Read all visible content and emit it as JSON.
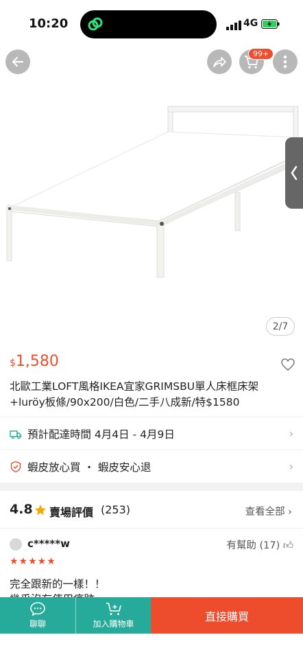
{
  "status": {
    "time": "10:20",
    "network": "4G"
  },
  "header": {
    "cart_badge": "99+"
  },
  "gallery": {
    "page_indicator": "2/7"
  },
  "product": {
    "currency": "$",
    "price": "1,580",
    "title": "北歐工業LOFT風格IKEA宜家GRIMSBU單人床框床架+luröy板條/90x200/白色/二手八成新/特$1580"
  },
  "shipping": {
    "label": "預計配達時間 4月4日 - 4月9日"
  },
  "guarantee": {
    "label": "蝦皮放心買 ・ 蝦皮安心退"
  },
  "ratings": {
    "score": "4.8",
    "title": "賣場評價",
    "count": "(253)",
    "view_all": "查看全部"
  },
  "review": {
    "user": "c*****w",
    "helpful": "有幫助 (17)",
    "stars": "★★★★★",
    "text_line1": "完全跟新的一樣！！",
    "text_line2": "幾乎沒有使用痕跡"
  },
  "bottom_bar": {
    "chat_label": "聊聊",
    "add_cart_label": "加入購物車",
    "buy_label": "直接購買"
  },
  "colors": {
    "accent": "#ee4d2d",
    "teal": "#26aa99"
  }
}
